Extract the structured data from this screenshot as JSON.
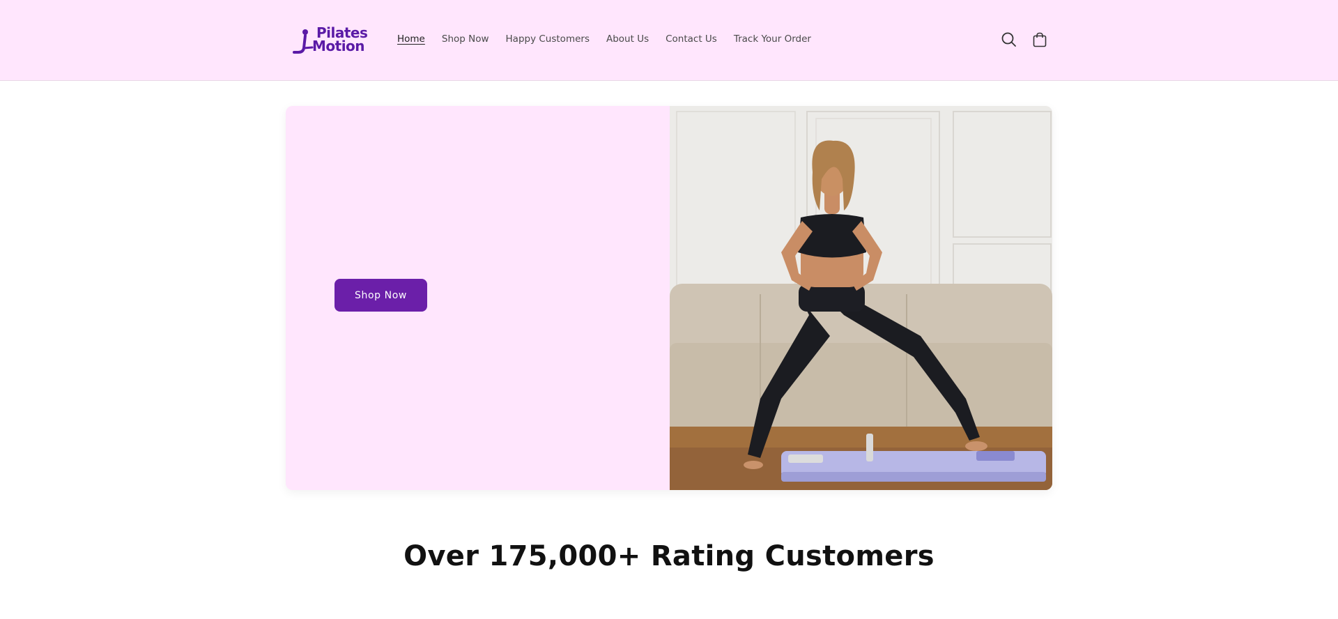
{
  "header": {
    "logo_text_line1": "Pilates",
    "logo_text_line2": "Motion",
    "nav": [
      {
        "label": "Home",
        "active": true
      },
      {
        "label": "Shop Now"
      },
      {
        "label": "Happy Customers"
      },
      {
        "label": "About Us"
      },
      {
        "label": "Contact Us"
      },
      {
        "label": "Track Your Order"
      }
    ],
    "icons": [
      "search-icon",
      "cart-icon"
    ]
  },
  "hero": {
    "button_label": "Shop Now",
    "image_subject": "woman in black sportswear doing a side lunge on a lavender pilates board in front of a beige sofa"
  },
  "ratings": {
    "title": "Over 175,000+ Rating Customers"
  },
  "colors": {
    "header_bg": "#ffe6fd",
    "accent": "#6b1fa9",
    "logo": "#5a1aa6"
  }
}
